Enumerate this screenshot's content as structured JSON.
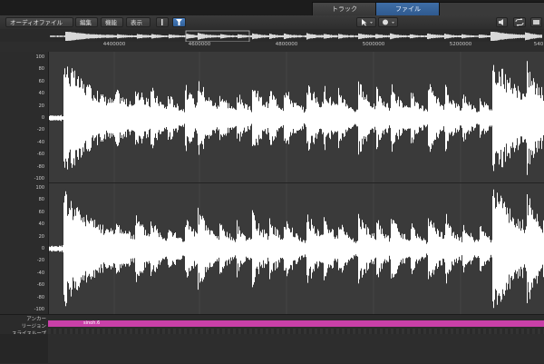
{
  "tabs": [
    {
      "label": "トラック",
      "active": false
    },
    {
      "label": "ファイル",
      "active": true
    }
  ],
  "toolbar": {
    "menus": [
      "オーディオファイル",
      "編集",
      "機能",
      "表示"
    ],
    "pointer_tool": "arrow-pointer-icon",
    "secondary_tool": "tool-icon",
    "active_button": "filter-icon"
  },
  "ruler": {
    "labels": [
      "4400000",
      "4600000",
      "4800000",
      "5000000",
      "5200000",
      "540"
    ]
  },
  "y_axis": {
    "ticks": [
      "100",
      "80",
      "60",
      "40",
      "20",
      "0",
      "-20",
      "-40",
      "-60",
      "-80",
      "-100"
    ]
  },
  "lanes": {
    "anchor": "アンカー",
    "region": "リージョン",
    "slice_loop": "スライスループ"
  },
  "region": {
    "name": "sinoh.6",
    "color": "#c940a8"
  },
  "colors": {
    "accent": "#3f6ea6",
    "waveform": "#ffffff",
    "background": "#3a3a3a"
  },
  "transients": [
    {
      "t": 0.03,
      "a": 0.98,
      "d": 0.08
    },
    {
      "t": 0.135,
      "a": 0.22,
      "d": 0.02
    },
    {
      "t": 0.175,
      "a": 0.38,
      "d": 0.025
    },
    {
      "t": 0.205,
      "a": 0.33,
      "d": 0.02
    },
    {
      "t": 0.24,
      "a": 0.28,
      "d": 0.02
    },
    {
      "t": 0.275,
      "a": 0.45,
      "d": 0.025
    },
    {
      "t": 0.3,
      "a": 0.52,
      "d": 0.03
    },
    {
      "t": 0.345,
      "a": 0.3,
      "d": 0.02
    },
    {
      "t": 0.38,
      "a": 0.32,
      "d": 0.02
    },
    {
      "t": 0.41,
      "a": 0.5,
      "d": 0.03
    },
    {
      "t": 0.445,
      "a": 0.36,
      "d": 0.02
    },
    {
      "t": 0.475,
      "a": 0.42,
      "d": 0.025
    },
    {
      "t": 0.52,
      "a": 0.55,
      "d": 0.03
    },
    {
      "t": 0.555,
      "a": 0.38,
      "d": 0.02
    },
    {
      "t": 0.585,
      "a": 0.37,
      "d": 0.02
    },
    {
      "t": 0.625,
      "a": 0.52,
      "d": 0.03
    },
    {
      "t": 0.66,
      "a": 0.34,
      "d": 0.02
    },
    {
      "t": 0.69,
      "a": 0.45,
      "d": 0.025
    },
    {
      "t": 0.73,
      "a": 0.32,
      "d": 0.02
    },
    {
      "t": 0.765,
      "a": 0.5,
      "d": 0.03
    },
    {
      "t": 0.8,
      "a": 0.4,
      "d": 0.02
    },
    {
      "t": 0.835,
      "a": 0.33,
      "d": 0.02
    },
    {
      "t": 0.87,
      "a": 0.3,
      "d": 0.02
    },
    {
      "t": 0.895,
      "a": 0.98,
      "d": 0.07
    },
    {
      "t": 0.965,
      "a": 0.55,
      "d": 0.03
    }
  ]
}
